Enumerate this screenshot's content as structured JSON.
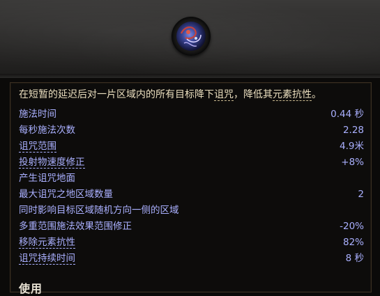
{
  "description": {
    "pre": "在短暂的延迟后对一片区域内的所有目标降下",
    "kw1": "诅咒",
    "mid": "，降低其",
    "kw2": "元素抗性",
    "end": "。"
  },
  "stats": [
    {
      "label": "施法时间",
      "value": "0.44 秒",
      "keyword": false
    },
    {
      "label": "每秒施法次数",
      "value": "2.28",
      "keyword": false
    },
    {
      "label": "诅咒范围",
      "value": "4.9米",
      "keyword": true
    },
    {
      "label": "投射物速度修正",
      "value": "+8%",
      "keyword": true
    },
    {
      "label": "产生诅咒地面",
      "value": "",
      "keyword": false
    },
    {
      "label": "最大诅咒之地区域数量",
      "value": "2",
      "keyword": false
    },
    {
      "label": "同时影响目标区域随机方向一侧的区域",
      "value": "",
      "keyword": false
    },
    {
      "label": "多重范围施法效果范围修正",
      "value": "-20%",
      "keyword": false
    },
    {
      "label": "移除元素抗性",
      "value": "82%",
      "keyword": true
    },
    {
      "label": "诅咒持续时间",
      "value": "8 秒",
      "keyword": true
    }
  ],
  "section_title": "使用",
  "colors": {
    "stat_text": "#aab0ff",
    "description_text": "#ebdfbf"
  },
  "icon": "skill-gem-icon"
}
